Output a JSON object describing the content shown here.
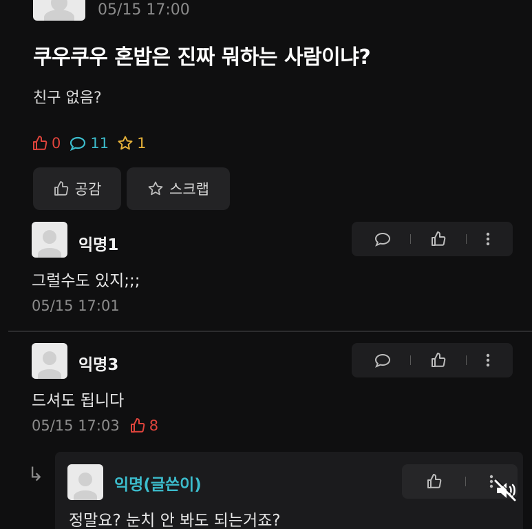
{
  "post": {
    "time": "05/15 17:00",
    "title": "쿠우쿠우 혼밥은 진짜 뭐하는 사람이냐?",
    "body": "친구 없음?",
    "stats": {
      "likes": "0",
      "comments": "11",
      "scraps": "1"
    },
    "buttons": {
      "like": "공감",
      "scrap": "스크랩"
    }
  },
  "comments": [
    {
      "name": "익명1",
      "text": "그럴수도 있지;;;",
      "time": "05/15 17:01",
      "likes": ""
    },
    {
      "name": "익명3",
      "text": "드셔도 됩니다",
      "time": "05/15 17:03",
      "likes": "8"
    }
  ],
  "reply": {
    "name": "익명(글쓴이)",
    "text": "정말요? 눈치 안 봐도 되는거죠?"
  },
  "colors": {
    "background": "#0f0f10",
    "like": "#e0443c",
    "comment": "#3cbccc",
    "scrap": "#e8b33a",
    "author": "#3cbccc"
  }
}
